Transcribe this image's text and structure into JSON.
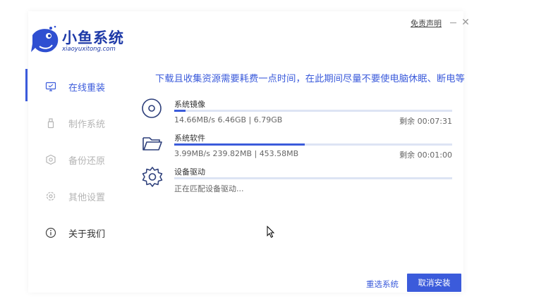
{
  "app": {
    "logo_title": "小鱼系统",
    "logo_subtitle": "xiaoyuxitong.com",
    "disclaimer": "免责声明",
    "brand_color": "#3b5bdb"
  },
  "sidebar": {
    "items": [
      {
        "label": "在线重装",
        "icon": "monitor-icon",
        "state": "active"
      },
      {
        "label": "制作系统",
        "icon": "usb-icon",
        "state": "inactive"
      },
      {
        "label": "备份还原",
        "icon": "backup-icon",
        "state": "inactive"
      },
      {
        "label": "其他设置",
        "icon": "gear-icon",
        "state": "inactive"
      },
      {
        "label": "关于我们",
        "icon": "info-icon",
        "state": "normal"
      }
    ]
  },
  "main": {
    "headline": "下载且收集资源需要耗费一点时间，在此期间尽量不要使电脑休眠、断电等",
    "tasks": [
      {
        "name": "系统镜像",
        "icon": "disc-icon",
        "detail": "14.66MB/s 6.46GB | 6.79GB",
        "remaining": "剩余 00:07:31",
        "progress": 0.04
      },
      {
        "name": "系统软件",
        "icon": "folder-icon",
        "detail": "3.99MB/s 239.82MB | 453.58MB",
        "remaining": "剩余 00:01:00",
        "progress": 0.47
      },
      {
        "name": "设备驱动",
        "icon": "gear-icon",
        "detail": "正在匹配设备驱动...",
        "remaining": "",
        "progress": 0
      }
    ]
  },
  "footer": {
    "reselect": "重选系统",
    "cancel": "取消安装"
  }
}
